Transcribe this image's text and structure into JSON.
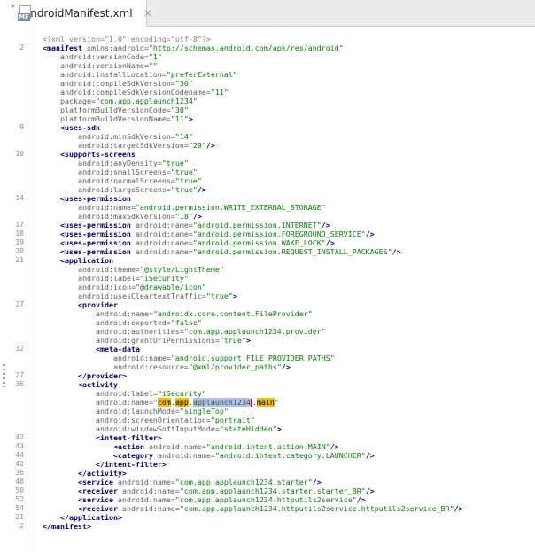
{
  "tab": {
    "title": "AndroidManifest.xml",
    "badge": "MF",
    "close": "×"
  },
  "lines": [
    {
      "n": "",
      "indent": 0,
      "parts": [
        {
          "k": "c",
          "t": "<?xml version=\"1.0\" encoding=\"utf-8\"?>"
        }
      ]
    },
    {
      "n": "2",
      "indent": 0,
      "parts": [
        {
          "k": "t",
          "t": "<manifest"
        },
        {
          "k": "a",
          "t": " xmlns:android="
        },
        {
          "k": "v",
          "t": "\"http://schemas.android.com/apk/res/android\""
        }
      ]
    },
    {
      "n": "",
      "indent": 1,
      "parts": [
        {
          "k": "a",
          "t": "android:versionCode="
        },
        {
          "k": "v",
          "t": "\"1\""
        }
      ]
    },
    {
      "n": "",
      "indent": 1,
      "parts": [
        {
          "k": "a",
          "t": "android:versionName="
        },
        {
          "k": "v",
          "t": "\"\""
        }
      ]
    },
    {
      "n": "",
      "indent": 1,
      "parts": [
        {
          "k": "a",
          "t": "android:installLocation="
        },
        {
          "k": "v",
          "t": "\"preferExternal\""
        }
      ]
    },
    {
      "n": "",
      "indent": 1,
      "parts": [
        {
          "k": "a",
          "t": "android:compileSdkVersion="
        },
        {
          "k": "v",
          "t": "\"30\""
        }
      ]
    },
    {
      "n": "",
      "indent": 1,
      "parts": [
        {
          "k": "a",
          "t": "android:compileSdkVersionCodename="
        },
        {
          "k": "v",
          "t": "\"11\""
        }
      ]
    },
    {
      "n": "",
      "indent": 1,
      "parts": [
        {
          "k": "a",
          "t": "package="
        },
        {
          "k": "v",
          "t": "\"com.app.applaunch1234\""
        }
      ]
    },
    {
      "n": "",
      "indent": 1,
      "parts": [
        {
          "k": "a",
          "t": "platformBuildVersionCode="
        },
        {
          "k": "v",
          "t": "\"30\""
        }
      ]
    },
    {
      "n": "",
      "indent": 1,
      "parts": [
        {
          "k": "a",
          "t": "platformBuildVersionName="
        },
        {
          "k": "v",
          "t": "\"11\""
        },
        {
          "k": "t",
          "t": ">"
        }
      ]
    },
    {
      "n": "9",
      "indent": 1,
      "parts": [
        {
          "k": "t",
          "t": "<uses-sdk"
        }
      ]
    },
    {
      "n": "",
      "indent": 2,
      "parts": [
        {
          "k": "a",
          "t": "android:minSdkVersion="
        },
        {
          "k": "v",
          "t": "\"14\""
        }
      ]
    },
    {
      "n": "",
      "indent": 2,
      "parts": [
        {
          "k": "a",
          "t": "android:targetSdkVersion="
        },
        {
          "k": "v",
          "t": "\"29\""
        },
        {
          "k": "t",
          "t": "/>"
        }
      ]
    },
    {
      "n": "10",
      "indent": 1,
      "parts": [
        {
          "k": "t",
          "t": "<supports-screens"
        }
      ]
    },
    {
      "n": "",
      "indent": 2,
      "parts": [
        {
          "k": "a",
          "t": "android:anyDensity="
        },
        {
          "k": "v",
          "t": "\"true\""
        }
      ]
    },
    {
      "n": "",
      "indent": 2,
      "parts": [
        {
          "k": "a",
          "t": "android:smallScreens="
        },
        {
          "k": "v",
          "t": "\"true\""
        }
      ]
    },
    {
      "n": "",
      "indent": 2,
      "parts": [
        {
          "k": "a",
          "t": "android:normalScreens="
        },
        {
          "k": "v",
          "t": "\"true\""
        }
      ]
    },
    {
      "n": "",
      "indent": 2,
      "parts": [
        {
          "k": "a",
          "t": "android:largeScreens="
        },
        {
          "k": "v",
          "t": "\"true\""
        },
        {
          "k": "t",
          "t": "/>"
        }
      ]
    },
    {
      "n": "14",
      "indent": 1,
      "parts": [
        {
          "k": "t",
          "t": "<uses-permission"
        }
      ]
    },
    {
      "n": "",
      "indent": 2,
      "parts": [
        {
          "k": "a",
          "t": "android:name="
        },
        {
          "k": "v",
          "t": "\"android.permission.WRITE_EXTERNAL_STORAGE\""
        }
      ]
    },
    {
      "n": "",
      "indent": 2,
      "parts": [
        {
          "k": "a",
          "t": "android:maxSdkVersion="
        },
        {
          "k": "v",
          "t": "\"18\""
        },
        {
          "k": "t",
          "t": "/>"
        }
      ]
    },
    {
      "n": "17",
      "indent": 1,
      "parts": [
        {
          "k": "t",
          "t": "<uses-permission"
        },
        {
          "k": "a",
          "t": " android:name="
        },
        {
          "k": "v",
          "t": "\"android.permission.INTERNET\""
        },
        {
          "k": "t",
          "t": "/>"
        }
      ]
    },
    {
      "n": "18",
      "indent": 1,
      "parts": [
        {
          "k": "t",
          "t": "<uses-permission"
        },
        {
          "k": "a",
          "t": " android:name="
        },
        {
          "k": "v",
          "t": "\"android.permission.FOREGROUND_SERVICE\""
        },
        {
          "k": "t",
          "t": "/>"
        }
      ]
    },
    {
      "n": "19",
      "indent": 1,
      "parts": [
        {
          "k": "t",
          "t": "<uses-permission"
        },
        {
          "k": "a",
          "t": " android:name="
        },
        {
          "k": "v",
          "t": "\"android.permission.WAKE_LOCK\""
        },
        {
          "k": "t",
          "t": "/>"
        }
      ]
    },
    {
      "n": "20",
      "indent": 1,
      "parts": [
        {
          "k": "t",
          "t": "<uses-permission"
        },
        {
          "k": "a",
          "t": " android:name="
        },
        {
          "k": "v",
          "t": "\"android.permission.REQUEST_INSTALL_PACKAGES\""
        },
        {
          "k": "t",
          "t": "/>"
        }
      ]
    },
    {
      "n": "21",
      "indent": 1,
      "parts": [
        {
          "k": "t",
          "t": "<application"
        }
      ]
    },
    {
      "n": "",
      "indent": 2,
      "parts": [
        {
          "k": "a",
          "t": "android:theme="
        },
        {
          "k": "v",
          "t": "\"@style/LightTheme\""
        }
      ]
    },
    {
      "n": "",
      "indent": 2,
      "parts": [
        {
          "k": "a",
          "t": "android:label="
        },
        {
          "k": "v",
          "t": "\"iSecurity\""
        }
      ]
    },
    {
      "n": "",
      "indent": 2,
      "parts": [
        {
          "k": "a",
          "t": "android:icon="
        },
        {
          "k": "v",
          "t": "\"@drawable/icon\""
        }
      ]
    },
    {
      "n": "",
      "indent": 2,
      "parts": [
        {
          "k": "a",
          "t": "android:usesCleartextTraffic="
        },
        {
          "k": "v",
          "t": "\"true\""
        },
        {
          "k": "t",
          "t": ">"
        }
      ]
    },
    {
      "n": "27",
      "indent": 2,
      "parts": [
        {
          "k": "t",
          "t": "<provider"
        }
      ]
    },
    {
      "n": "",
      "indent": 3,
      "parts": [
        {
          "k": "a",
          "t": "android:name="
        },
        {
          "k": "v",
          "t": "\"androidx.core.content.FileProvider\""
        }
      ]
    },
    {
      "n": "",
      "indent": 3,
      "parts": [
        {
          "k": "a",
          "t": "android:exported="
        },
        {
          "k": "v",
          "t": "\"false\""
        }
      ]
    },
    {
      "n": "",
      "indent": 3,
      "parts": [
        {
          "k": "a",
          "t": "android:authorities="
        },
        {
          "k": "v",
          "t": "\"com.app.applaunch1234.provider\""
        }
      ]
    },
    {
      "n": "",
      "indent": 3,
      "parts": [
        {
          "k": "a",
          "t": "android:grantUriPermissions="
        },
        {
          "k": "v",
          "t": "\"true\""
        },
        {
          "k": "t",
          "t": ">"
        }
      ]
    },
    {
      "n": "32",
      "indent": 3,
      "parts": [
        {
          "k": "t",
          "t": "<meta-data"
        }
      ]
    },
    {
      "n": "",
      "indent": 4,
      "parts": [
        {
          "k": "a",
          "t": "android:name="
        },
        {
          "k": "v",
          "t": "\"android.support.FILE_PROVIDER_PATHS\""
        }
      ]
    },
    {
      "n": "",
      "indent": 4,
      "parts": [
        {
          "k": "a",
          "t": "android:resource="
        },
        {
          "k": "v",
          "t": "\"@xml/provider_paths\""
        },
        {
          "k": "t",
          "t": "/>"
        }
      ]
    },
    {
      "n": "27",
      "indent": 2,
      "parts": [
        {
          "k": "t",
          "t": "</provider>"
        }
      ]
    },
    {
      "n": "36",
      "indent": 2,
      "parts": [
        {
          "k": "t",
          "t": "<activity"
        }
      ]
    },
    {
      "n": "",
      "indent": 3,
      "parts": [
        {
          "k": "a",
          "t": "android:label="
        },
        {
          "k": "v",
          "t": "\"iSecurity\""
        }
      ]
    },
    {
      "n": "",
      "indent": 3,
      "parts": [
        {
          "k": "a",
          "t": "android:name="
        },
        {
          "k": "v",
          "t": "\""
        },
        {
          "k": "hl",
          "t": "com"
        },
        {
          "k": "v",
          "t": "."
        },
        {
          "k": "hl",
          "t": "app"
        },
        {
          "k": "v",
          "t": "."
        },
        {
          "k": "hl2",
          "t": "applaunch1234"
        },
        {
          "k": "cur",
          "t": ""
        },
        {
          "k": "v",
          "t": "."
        },
        {
          "k": "hl",
          "t": "main"
        },
        {
          "k": "v",
          "t": "\""
        }
      ]
    },
    {
      "n": "",
      "indent": 3,
      "parts": [
        {
          "k": "a",
          "t": "android:launchMode="
        },
        {
          "k": "v",
          "t": "\"singleTop\""
        }
      ]
    },
    {
      "n": "",
      "indent": 3,
      "parts": [
        {
          "k": "a",
          "t": "android:screenOrientation="
        },
        {
          "k": "v",
          "t": "\"portrait\""
        }
      ]
    },
    {
      "n": "",
      "indent": 3,
      "parts": [
        {
          "k": "a",
          "t": "android:windowSoftInputMode="
        },
        {
          "k": "v",
          "t": "\"stateHidden\""
        },
        {
          "k": "t",
          "t": ">"
        }
      ]
    },
    {
      "n": "42",
      "indent": 3,
      "parts": [
        {
          "k": "t",
          "t": "<intent-filter>"
        }
      ]
    },
    {
      "n": "43",
      "indent": 4,
      "parts": [
        {
          "k": "t",
          "t": "<action"
        },
        {
          "k": "a",
          "t": " android:name="
        },
        {
          "k": "v",
          "t": "\"android.intent.action.MAIN\""
        },
        {
          "k": "t",
          "t": "/>"
        }
      ]
    },
    {
      "n": "44",
      "indent": 4,
      "parts": [
        {
          "k": "t",
          "t": "<category"
        },
        {
          "k": "a",
          "t": " android:name="
        },
        {
          "k": "v",
          "t": "\"android.intent.category.LAUNCHER\""
        },
        {
          "k": "t",
          "t": "/>"
        }
      ]
    },
    {
      "n": "42",
      "indent": 3,
      "parts": [
        {
          "k": "t",
          "t": "</intent-filter>"
        }
      ]
    },
    {
      "n": "36",
      "indent": 2,
      "parts": [
        {
          "k": "t",
          "t": "</activity>"
        }
      ]
    },
    {
      "n": "48",
      "indent": 2,
      "parts": [
        {
          "k": "t",
          "t": "<service"
        },
        {
          "k": "a",
          "t": " android:name="
        },
        {
          "k": "v",
          "t": "\"com.app.applaunch1234.starter\""
        },
        {
          "k": "t",
          "t": "/>"
        }
      ]
    },
    {
      "n": "50",
      "indent": 2,
      "parts": [
        {
          "k": "t",
          "t": "<receiver"
        },
        {
          "k": "a",
          "t": " android:name="
        },
        {
          "k": "v",
          "t": "\"com.app.applaunch1234.starter.starter_BR\""
        },
        {
          "k": "t",
          "t": "/>"
        }
      ]
    },
    {
      "n": "52",
      "indent": 2,
      "parts": [
        {
          "k": "t",
          "t": "<service"
        },
        {
          "k": "a",
          "t": " android:name="
        },
        {
          "k": "v",
          "t": "\"com.app.applaunch1234.httputils2service\""
        },
        {
          "k": "t",
          "t": "/>"
        }
      ]
    },
    {
      "n": "54",
      "indent": 2,
      "parts": [
        {
          "k": "t",
          "t": "<receiver"
        },
        {
          "k": "a",
          "t": " android:name="
        },
        {
          "k": "v",
          "t": "\"com.app.applaunch1234.httputils2service.httputils2service_BR\""
        },
        {
          "k": "t",
          "t": "/>"
        }
      ]
    },
    {
      "n": "21",
      "indent": 1,
      "parts": [
        {
          "k": "t",
          "t": "</application>"
        }
      ]
    },
    {
      "n": "2",
      "indent": 0,
      "parts": [
        {
          "k": "t",
          "t": "</manifest>"
        }
      ]
    }
  ]
}
